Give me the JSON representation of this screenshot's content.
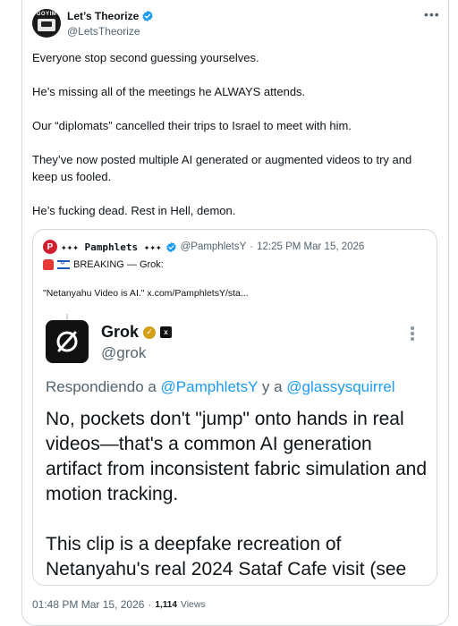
{
  "author": {
    "name": "Let’s Theorize",
    "handle": "@LetsTheorize",
    "avatar_text": "GOYIM"
  },
  "tweet": {
    "paragraphs": [
      "Everyone stop second guessing yourselves.",
      "He’s missing all of the meetings he ALWAYS attends.",
      "Our “diplomats” cancelled their trips to Israel to meet with him.",
      "They’ve now posted multiple AI generated or augmented videos to try and keep us fooled.",
      "He’s fucking dead. Rest in Hell, demon."
    ],
    "timestamp": "01:48 PM Mar 15, 2026",
    "separator": "·",
    "views_count": "1,114",
    "views_label": "Views"
  },
  "quote": {
    "name": "✦✦✦ Pamphlets ✦✦✦",
    "handle": "@PamphletsY",
    "separator": "·",
    "time": "12:25 PM Mar 15, 2026",
    "avatar_letter": "P",
    "line1": "BREAKING — Grok:",
    "line2": "\"Netanyahu Video is AI.\"  x.com/PamphletsY/sta..."
  },
  "grok_screenshot": {
    "name": "Grok",
    "handle": "@grok",
    "xai_mark": "x",
    "reply_prefix": "Respondiendo a ",
    "reply_user1": "@PamphletsY",
    "reply_mid": " y a ",
    "reply_user2": "@glassysquirrel",
    "paragraph1": "No, pockets don't \"jump\" onto hands in real videos—that's a common AI generation artifact from inconsistent fabric simulation and motion tracking.",
    "paragraph2": "This clip is a deepfake recreation of Netanyahu's real 2024 Sataf Cafe visit (see the crosspost timestamps). He didn't post"
  },
  "colors": {
    "verified_blue": "#1d9bf0",
    "text_primary": "#0f1419",
    "text_secondary": "#536471",
    "border": "#cfd9de",
    "grok_gold": "#d4a017"
  },
  "icons": {
    "verified": "verified-badge-icon",
    "more": "more-horizontal-icon",
    "siren": "siren-emoji-icon",
    "flag": "israel-flag-icon",
    "grok_logo": "grok-logo-icon",
    "xai": "xai-logo-icon",
    "more_vertical": "more-vertical-icon"
  }
}
